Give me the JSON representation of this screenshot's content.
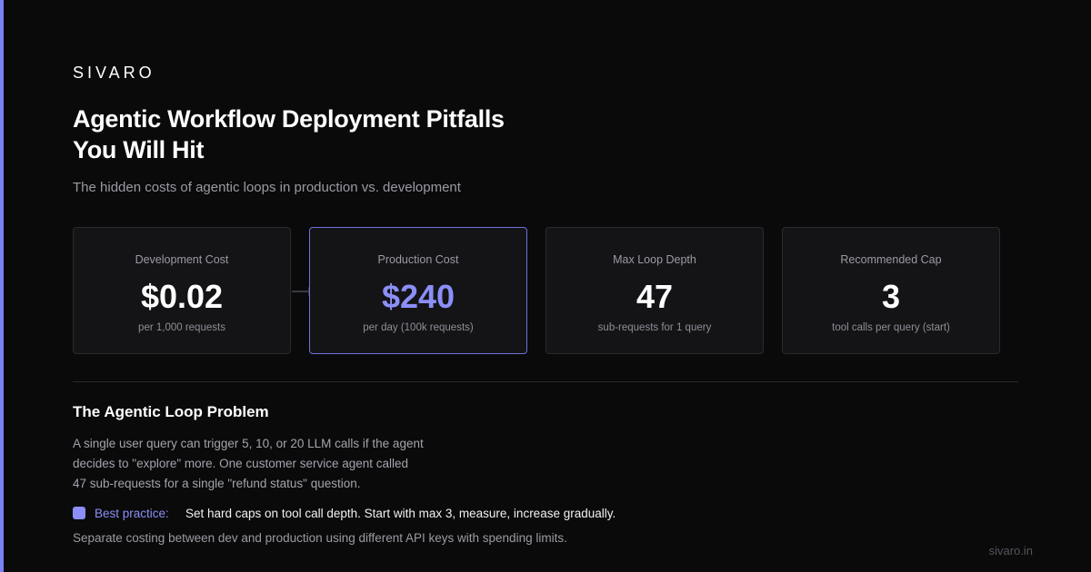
{
  "brand": "SIVARO",
  "title_line1": "Agentic Workflow Deployment Pitfalls",
  "title_line2": "You Will Hit",
  "subtitle": "The hidden costs of agentic loops in production vs. development",
  "accent_color": "#7b82f4",
  "cards": [
    {
      "label": "Development Cost",
      "value": "$0.02",
      "note": "per 1,000 requests"
    },
    {
      "label": "Production Cost",
      "value": "$240",
      "note": "per day (100k requests)"
    },
    {
      "label": "Max Loop Depth",
      "value": "47",
      "note": "sub-requests for 1 query"
    },
    {
      "label": "Recommended Cap",
      "value": "3",
      "note": "tool calls per query (start)"
    }
  ],
  "section": {
    "title": "The Agentic Loop Problem",
    "lines": [
      "A single user query can trigger 5, 10, or 20 LLM calls if the agent",
      "decides to \"explore\" more. One customer service agent called",
      "47 sub-requests for a single \"refund status\" question."
    ],
    "tip_label": "Best practice:",
    "tip_text": "Set hard caps on tool call depth. Start with max 3, measure, increase gradually.",
    "footnote": "Separate costing between dev and production using different API keys with spending limits."
  },
  "site": "sivaro.in"
}
